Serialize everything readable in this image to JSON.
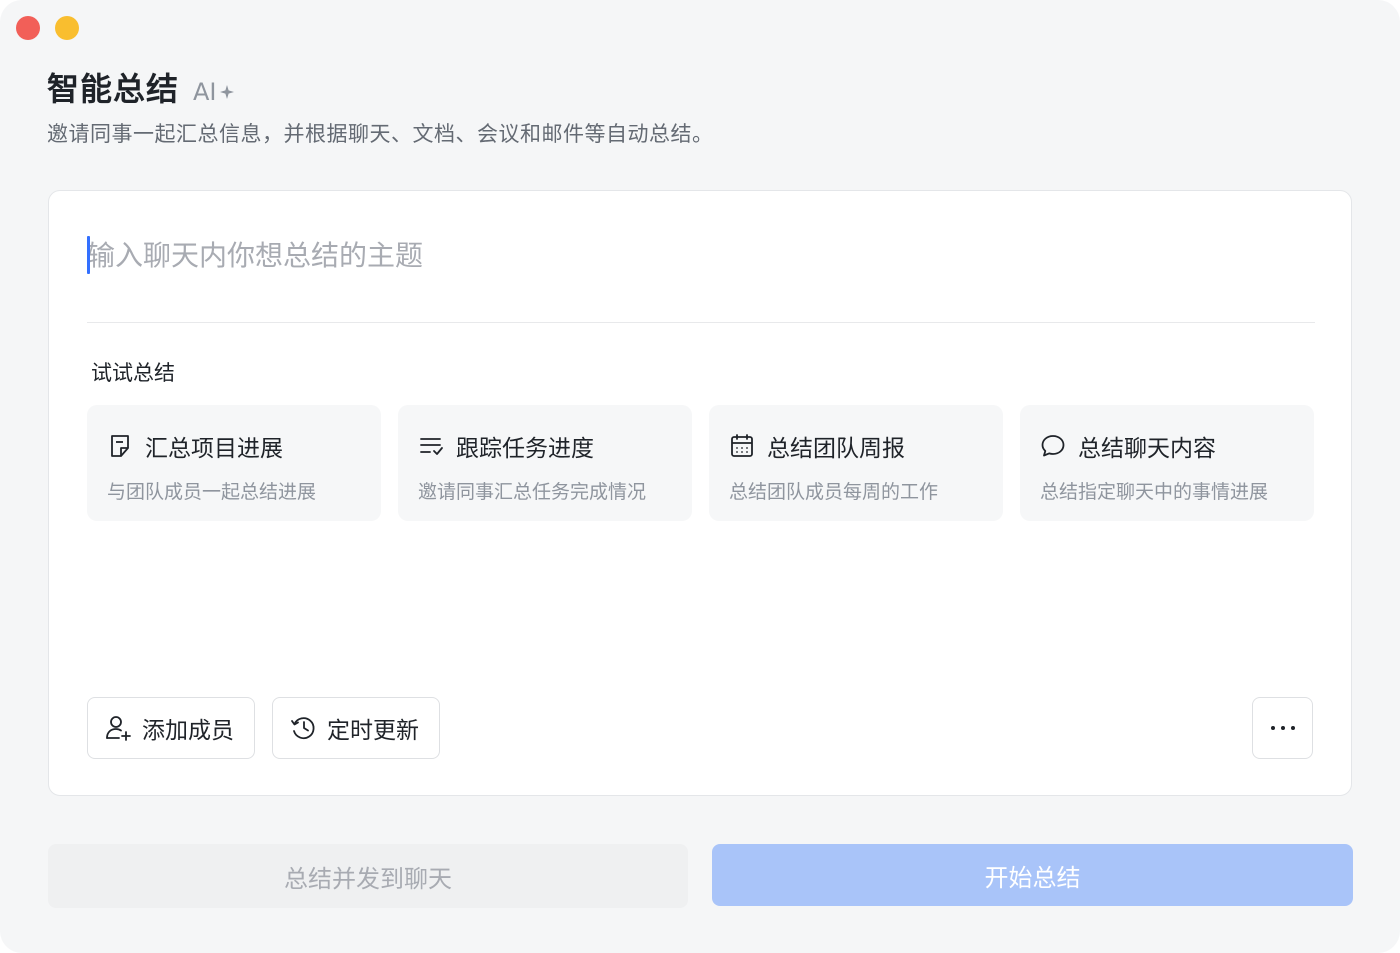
{
  "window": {
    "controls": [
      "close",
      "minimize"
    ]
  },
  "header": {
    "title": "智能总结",
    "badge": "AI",
    "badge_icon": "sparkle-icon",
    "subtitle": "邀请同事一起汇总信息，并根据聊天、文档、会议和邮件等自动总结。"
  },
  "input": {
    "placeholder": "输入聊天内你想总结的主题",
    "value": ""
  },
  "suggestions": {
    "label": "试试总结",
    "items": [
      {
        "icon": "document-icon",
        "title": "汇总项目进展",
        "desc": "与团队成员一起总结进展"
      },
      {
        "icon": "task-list-icon",
        "title": "跟踪任务进度",
        "desc": "邀请同事汇总任务完成情况"
      },
      {
        "icon": "calendar-icon",
        "title": "总结团队周报",
        "desc": "总结团队成员每周的工作"
      },
      {
        "icon": "chat-bubble-icon",
        "title": "总结聊天内容",
        "desc": "总结指定聊天中的事情进展"
      }
    ]
  },
  "actions": {
    "add_members": "添加成员",
    "add_members_icon": "add-user-icon",
    "scheduled_update": "定时更新",
    "scheduled_update_icon": "clock-refresh-icon",
    "more_icon": "more-icon"
  },
  "footer": {
    "send_to_chat": "总结并发到聊天",
    "start": "开始总结"
  },
  "colors": {
    "accent": "#3370ff",
    "primary_disabled": "#a9c4f9",
    "close": "#f25f58",
    "minimize": "#f9be2f"
  }
}
